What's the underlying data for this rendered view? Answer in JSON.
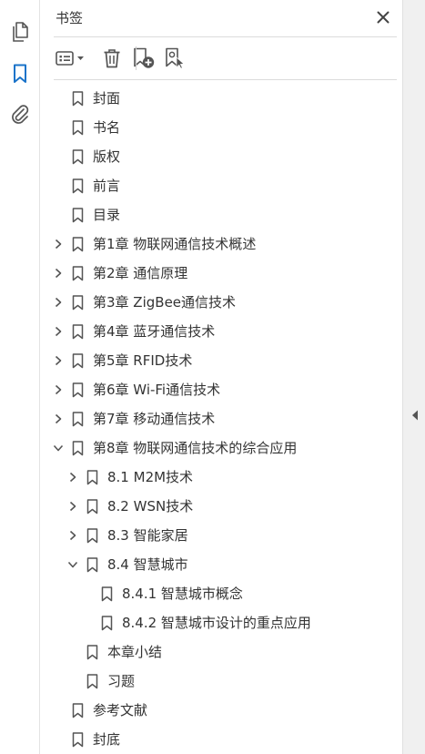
{
  "colors": {
    "accent": "#1a73c9",
    "icon_gray": "#555555",
    "text": "#333333"
  },
  "leftbar": {
    "items": [
      {
        "name": "pages-icon",
        "active": false
      },
      {
        "name": "bookmarks-icon",
        "active": true
      },
      {
        "name": "attachments-icon",
        "active": false
      }
    ]
  },
  "panel": {
    "title": "书签",
    "toolbar": [
      {
        "name": "options-menu-icon"
      },
      {
        "name": "delete-bookmark-icon"
      },
      {
        "name": "new-bookmark-icon"
      },
      {
        "name": "bookmark-from-selection-icon"
      }
    ]
  },
  "bookmarks": [
    {
      "label": "封面",
      "level": 0,
      "expand": "none"
    },
    {
      "label": "书名",
      "level": 0,
      "expand": "none"
    },
    {
      "label": "版权",
      "level": 0,
      "expand": "none"
    },
    {
      "label": "前言",
      "level": 0,
      "expand": "none"
    },
    {
      "label": "目录",
      "level": 0,
      "expand": "none"
    },
    {
      "label": "第1章  物联网通信技术概述",
      "level": 0,
      "expand": "collapsed"
    },
    {
      "label": "第2章  通信原理",
      "level": 0,
      "expand": "collapsed"
    },
    {
      "label": "第3章  ZigBee通信技术",
      "level": 0,
      "expand": "collapsed"
    },
    {
      "label": "第4章  蓝牙通信技术",
      "level": 0,
      "expand": "collapsed"
    },
    {
      "label": "第5章  RFID技术",
      "level": 0,
      "expand": "collapsed"
    },
    {
      "label": "第6章  Wi-Fi通信技术",
      "level": 0,
      "expand": "collapsed"
    },
    {
      "label": "第7章  移动通信技术",
      "level": 0,
      "expand": "collapsed"
    },
    {
      "label": "第8章  物联网通信技术的综合应用",
      "level": 0,
      "expand": "expanded"
    },
    {
      "label": "8.1  M2M技术",
      "level": 1,
      "expand": "collapsed"
    },
    {
      "label": "8.2  WSN技术",
      "level": 1,
      "expand": "collapsed"
    },
    {
      "label": "8.3  智能家居",
      "level": 1,
      "expand": "collapsed"
    },
    {
      "label": "8.4  智慧城市",
      "level": 1,
      "expand": "expanded"
    },
    {
      "label": "8.4.1  智慧城市概念",
      "level": 2,
      "expand": "none"
    },
    {
      "label": "8.4.2  智慧城市设计的重点应用",
      "level": 2,
      "expand": "none"
    },
    {
      "label": "本章小结",
      "level": 1,
      "expand": "none"
    },
    {
      "label": "习题",
      "level": 1,
      "expand": "none"
    },
    {
      "label": "参考文献",
      "level": 0,
      "expand": "none"
    },
    {
      "label": "封底",
      "level": 0,
      "expand": "none"
    }
  ]
}
